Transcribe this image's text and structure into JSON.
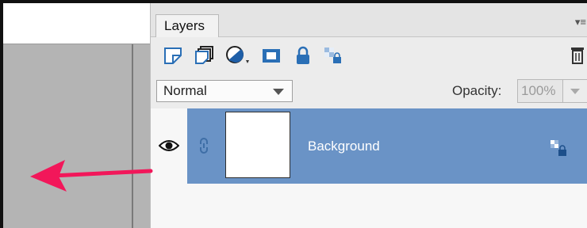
{
  "panel": {
    "tab_label": "Layers",
    "menu_glyph": "▾≡",
    "tools": [
      {
        "name": "new-layer-icon"
      },
      {
        "name": "new-group-icon"
      },
      {
        "name": "adjustment-layer-icon"
      },
      {
        "name": "add-mask-icon"
      },
      {
        "name": "lock-all-icon"
      },
      {
        "name": "lock-transparency-icon"
      },
      {
        "name": "delete-layer-icon"
      }
    ],
    "blend_mode": "Normal",
    "opacity_label": "Opacity:",
    "opacity_value": "100%"
  },
  "layers": [
    {
      "name": "Background",
      "visible": true,
      "selected": true
    }
  ],
  "colors": {
    "selection": "#6a93c6",
    "annotation_arrow": "#f2175a",
    "canvas_gray": "#b4b4b4"
  }
}
